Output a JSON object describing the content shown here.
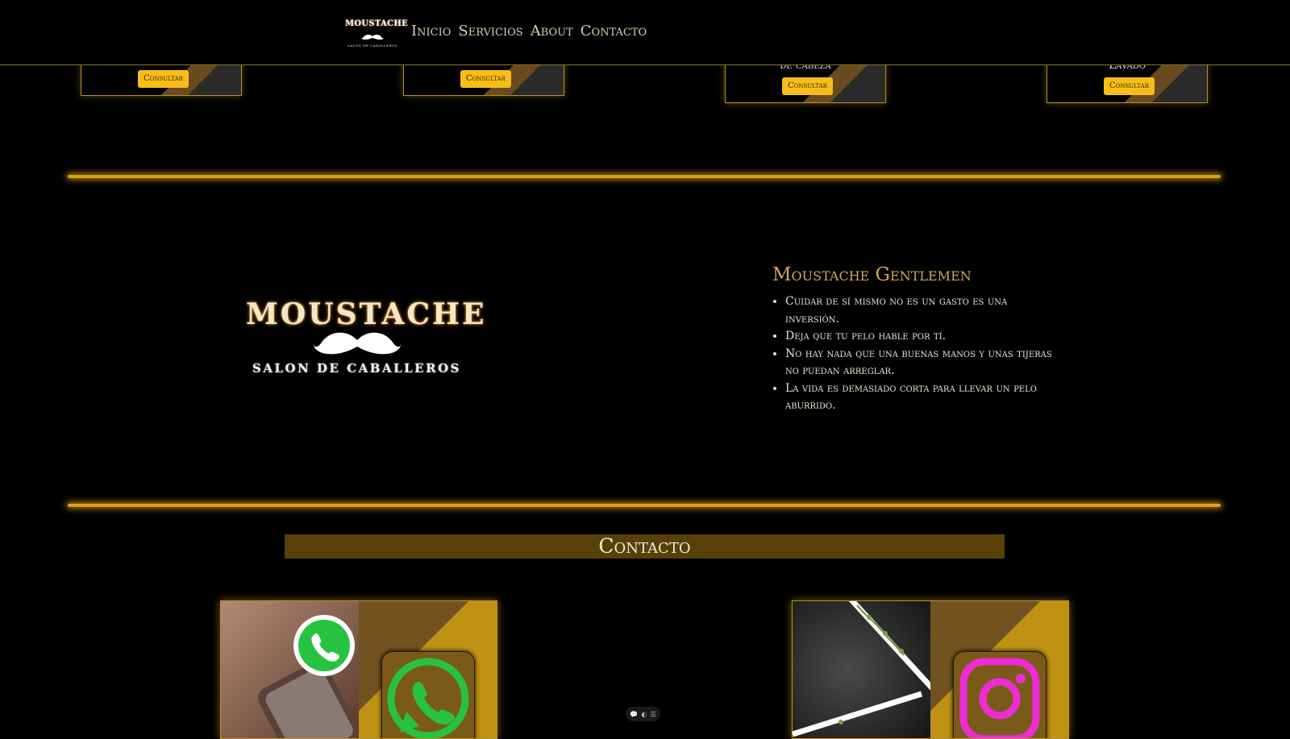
{
  "header": {
    "brand_name": "MOUSTACHE",
    "brand_tagline": "SALON DE CABALLEROS",
    "nav": [
      "Inicio",
      "Servicios",
      "About",
      "Contacto"
    ]
  },
  "services": {
    "cards": [
      {
        "label": "",
        "button": "Consultar"
      },
      {
        "label": "",
        "button": "Consultar"
      },
      {
        "label": "de cabeza",
        "button": "Consultar"
      },
      {
        "label": "Lavado",
        "button": "Consultar"
      }
    ]
  },
  "about": {
    "logo_title": "MOUSTACHE",
    "logo_subtitle": "SALON DE CABALLEROS",
    "heading": "Moustache Gentlemen",
    "quotes": [
      "Cuidar de sí mismo no es un gasto es una inversión.",
      "Deja que tu pelo hable por tí.",
      "No hay nada que una buenas manos y unas tijeras no puedan arreglar.",
      "La vida es demasiado corta para llevar un pelo aburrido."
    ]
  },
  "contact": {
    "heading": "Contacto",
    "cards": [
      {
        "icon": "whatsapp-icon",
        "color": "#27c340"
      },
      {
        "icon": "instagram-icon",
        "color": "#ee2cd6"
      }
    ]
  },
  "colors": {
    "accent": "#f7bd18",
    "gold_border": "#b8902a",
    "divider": "#e0a010",
    "contact_bar": "#574107",
    "heading_gold": "#d4a55a"
  }
}
